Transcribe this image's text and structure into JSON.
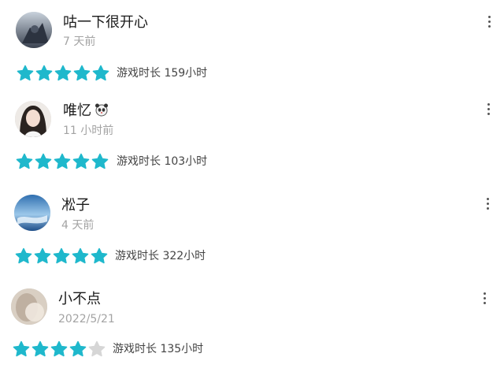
{
  "colors": {
    "star_filled": "#1fb8cc",
    "star_empty": "#d6d6d6"
  },
  "reviews": [
    {
      "name": "咕一下很开心",
      "time": "7 天前",
      "stars": 5,
      "playtime": "游戏时长 159小时",
      "avatar_icon": "avatar-dark-photo",
      "name_badge_icon": ""
    },
    {
      "name": "唯忆",
      "time": "11 小时前",
      "stars": 5,
      "playtime": "游戏时长 103小时",
      "avatar_icon": "avatar-girl-photo",
      "name_badge_icon": "panda-emoji-icon"
    },
    {
      "name": "凇子",
      "time": "4 天前",
      "stars": 5,
      "playtime": "游戏时长 322小时",
      "avatar_icon": "avatar-blue-sky-photo",
      "name_badge_icon": ""
    },
    {
      "name": "小不点",
      "time": "2022/5/21",
      "stars": 4,
      "playtime": "游戏时长 135小时",
      "avatar_icon": "avatar-blurry-photo",
      "name_badge_icon": ""
    }
  ]
}
